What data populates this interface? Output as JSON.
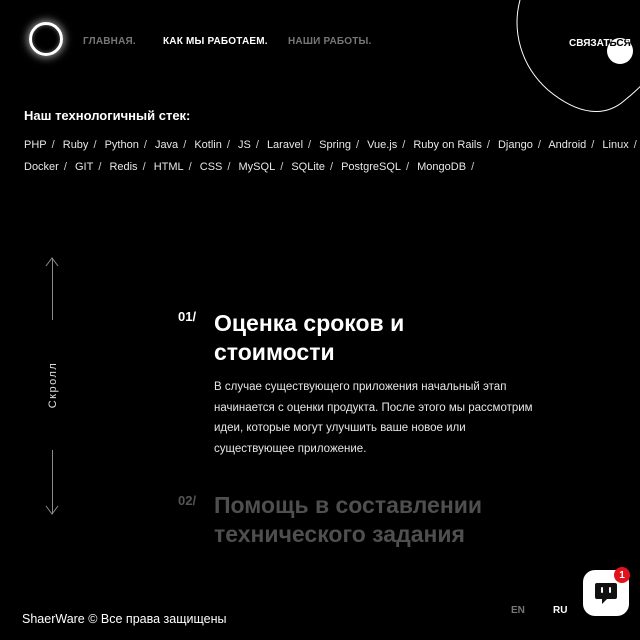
{
  "header": {
    "logo_icon": "ring-logo-icon",
    "nav": {
      "home": "ГЛАВНАЯ.",
      "how_we_work": "КАК МЫ РАБОТАЕМ.",
      "our_works": "НАШИ РАБОТЫ."
    },
    "contact_label": "СВЯЗАТЬСЯ"
  },
  "stack": {
    "title": "Наш технологичный стек:",
    "line1": [
      "PHP",
      "Ruby",
      "Python",
      "Java",
      "Kotlin",
      "JS",
      "Laravel",
      "Spring",
      "Vue.js",
      "Ruby on Rails",
      "Django",
      "Android",
      "Linux"
    ],
    "line2": [
      "Docker",
      "GIT",
      "Redis",
      "HTML",
      "CSS",
      "MySQL",
      "SQLite",
      "PostgreSQL",
      "MongoDB"
    ]
  },
  "scroll": {
    "label": "Скролл"
  },
  "steps": [
    {
      "number": "01/",
      "title_line1": "Оценка сроков и",
      "title_line2": "стоимости",
      "text_line1": "В случае существующего приложения начальный этап",
      "text_line2": "начинается с оценки продукта. После этого мы рассмотрим",
      "text_line3": "идеи, которые могут улучшить ваше новое или",
      "text_line4": "существующее приложение."
    },
    {
      "number": "02/",
      "title_line1": "Помощь в составлении",
      "title_line2": "технического задания"
    }
  ],
  "footer": {
    "copyright": "ShaerWare © Все права защищены",
    "lang_en": "EN",
    "lang_ru": "RU"
  },
  "chat": {
    "icon": "chat-bubble-icon",
    "badge_count": "1"
  },
  "colors": {
    "background": "#000000",
    "text": "#ffffff",
    "muted": "#777777",
    "badge": "#e0131d"
  }
}
